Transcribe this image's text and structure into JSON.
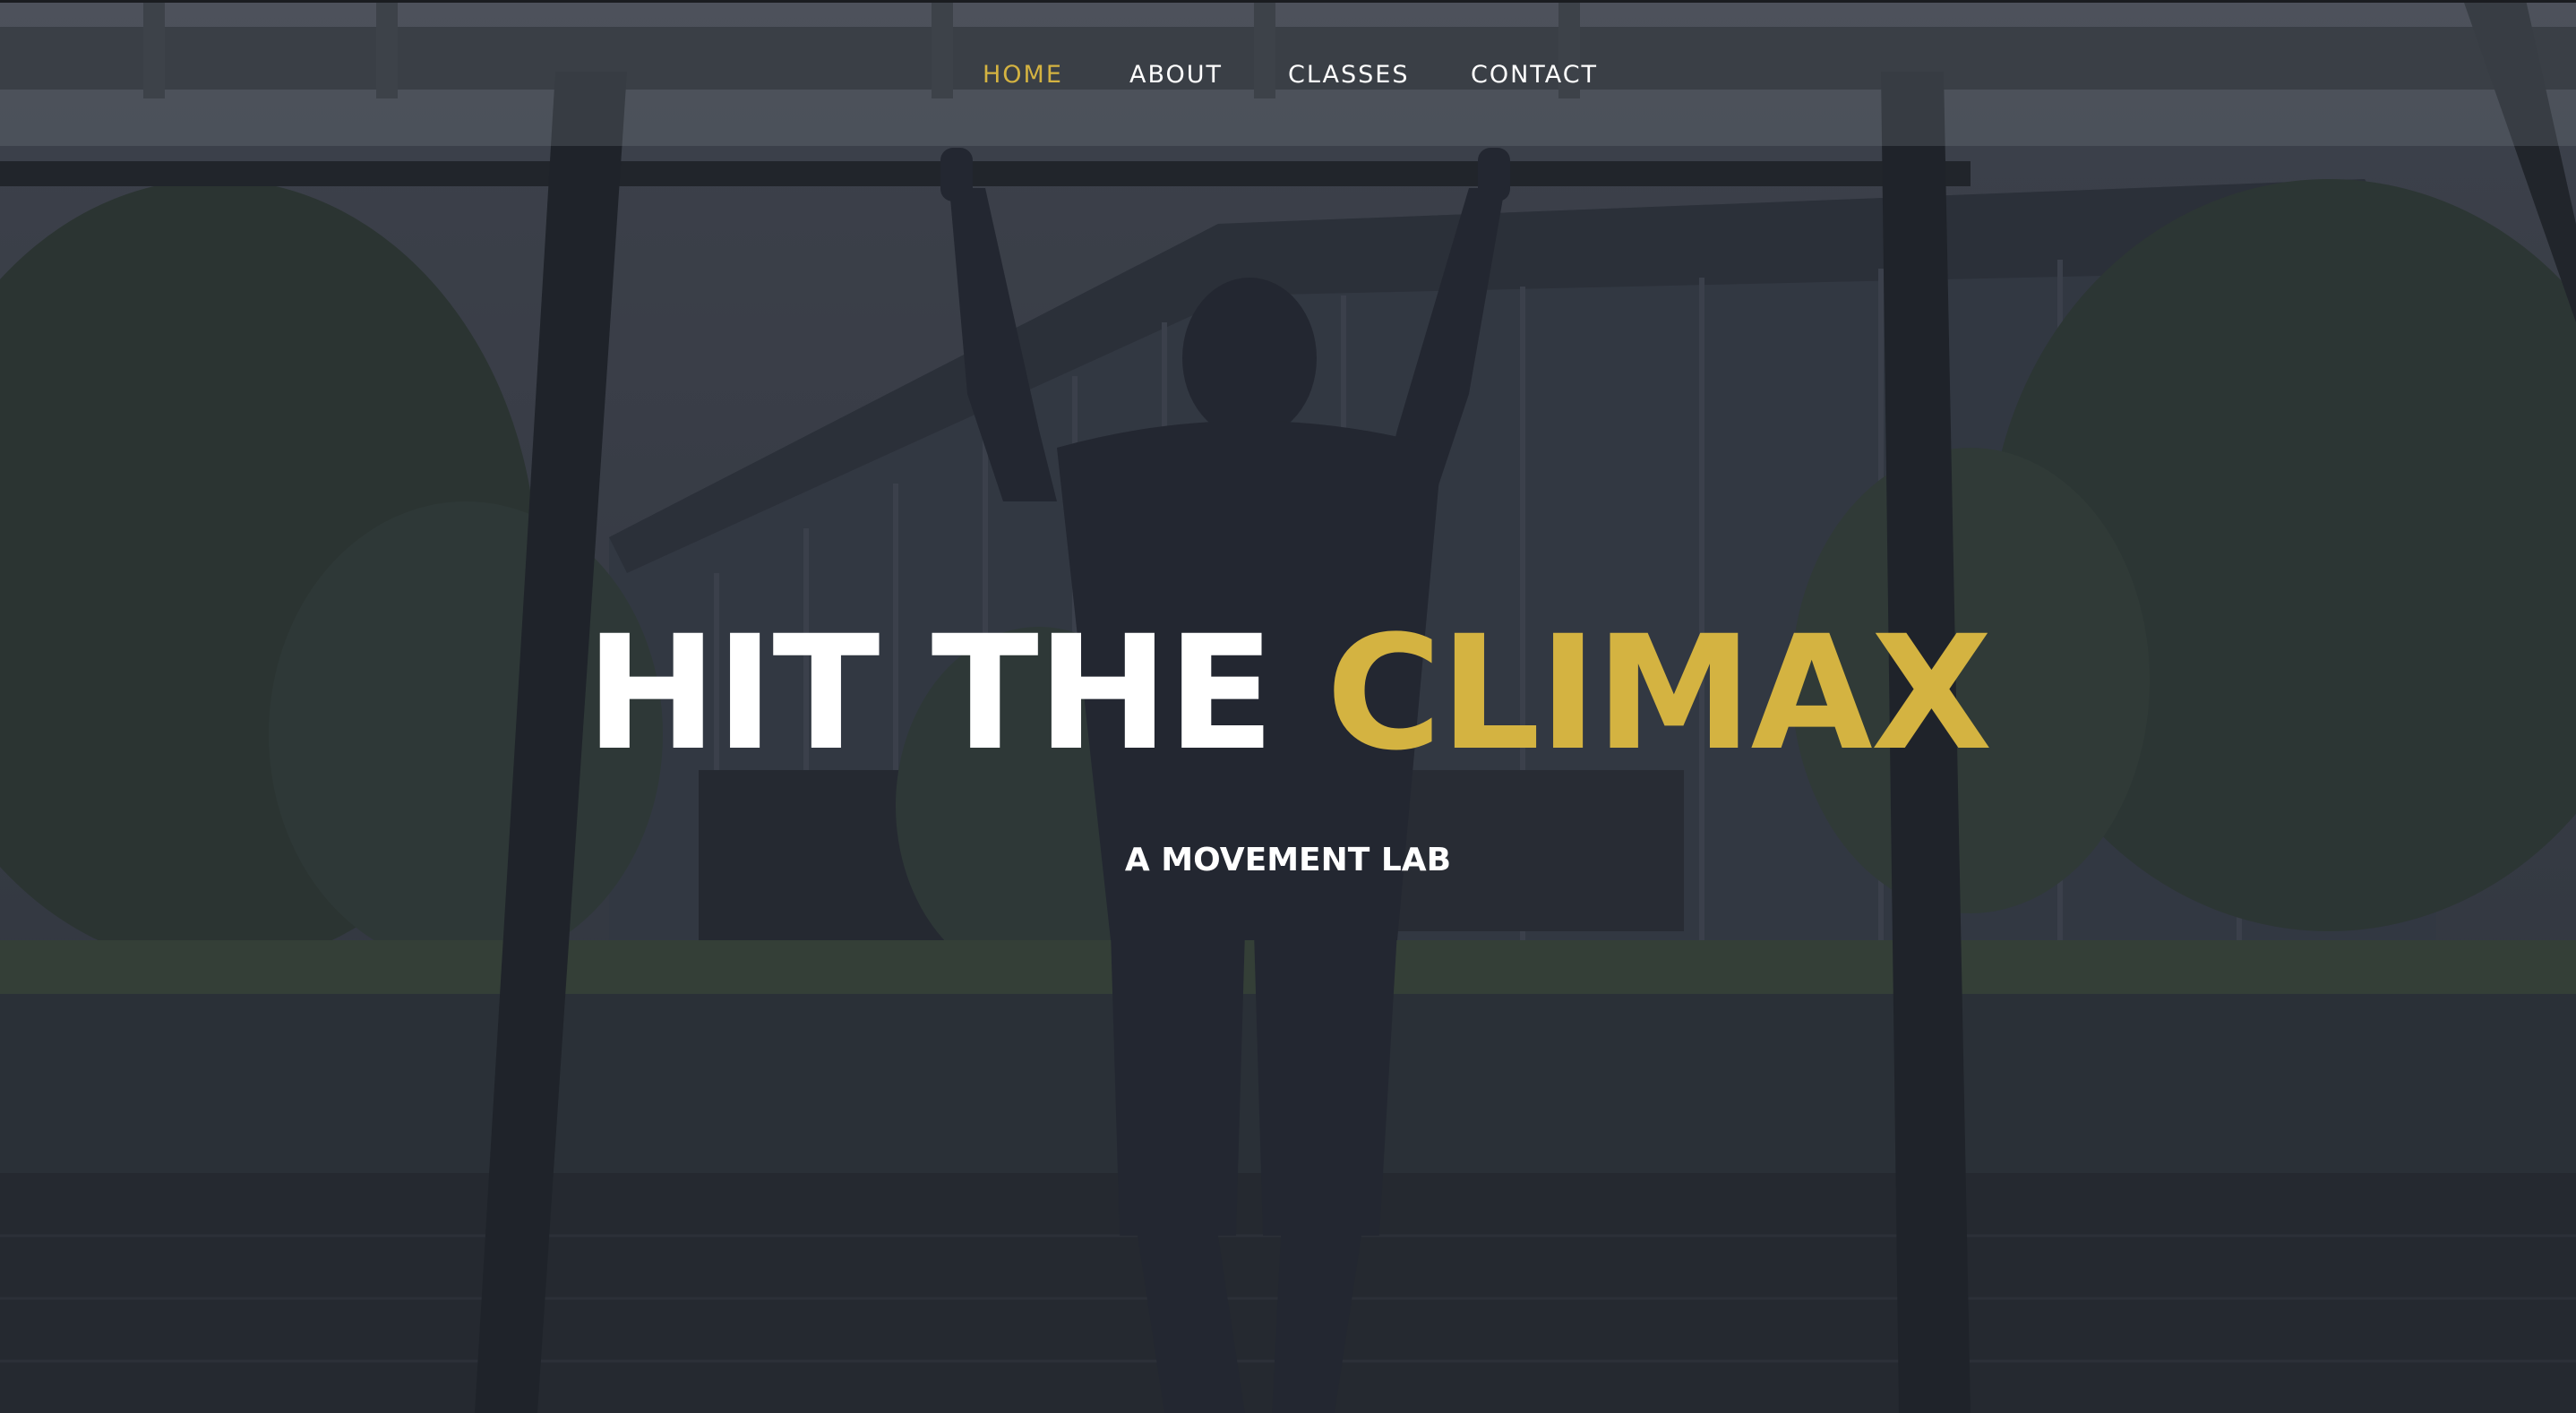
{
  "nav": {
    "items": [
      {
        "label": "HOME",
        "active": true
      },
      {
        "label": "ABOUT",
        "active": false
      },
      {
        "label": "CLASSES",
        "active": false
      },
      {
        "label": "CONTACT",
        "active": false
      }
    ]
  },
  "hero": {
    "title_part1": "HIT THE",
    "title_part2": "CLIMAX",
    "subtitle": "A MOVEMENT LAB"
  },
  "colors": {
    "accent": "#d4b341",
    "text": "#ffffff",
    "overlay": "#2b2f37"
  },
  "background": {
    "image_subject": "athlete-hanging-from-pull-up-bar-silhouette"
  }
}
